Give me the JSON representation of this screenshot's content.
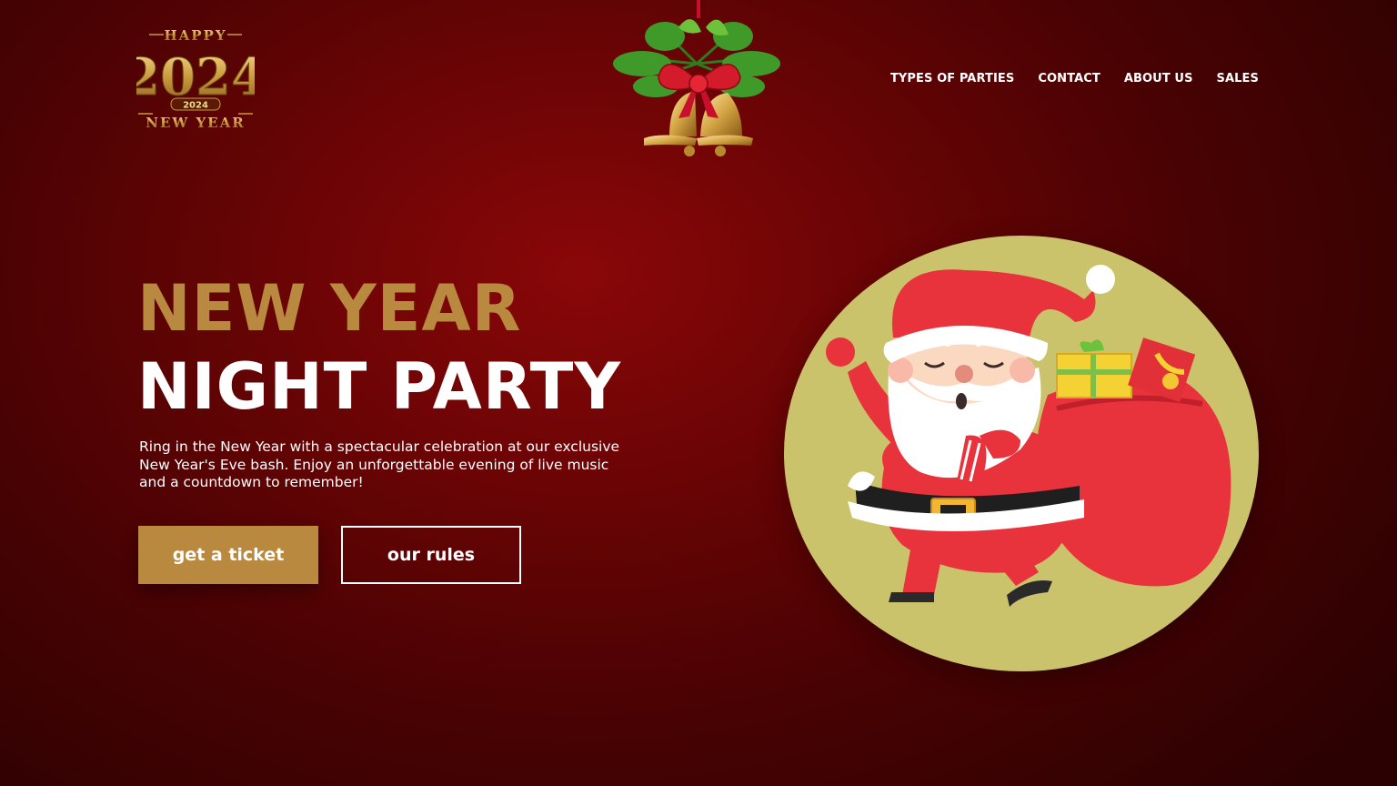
{
  "logo": {
    "top_text": "HAPPY",
    "year": "2024",
    "ribbon_year": "2024",
    "bottom_text": "NEW YEAR"
  },
  "nav": {
    "items": [
      "TYPES OF PARTIES",
      "CONTACT",
      "ABOUT US",
      "SALES"
    ]
  },
  "hero": {
    "title_line1": "NEW YEAR",
    "title_line2": "NIGHT PARTY",
    "description": "Ring in the New Year with a spectacular celebration at our exclusive New Year's Eve bash. Enjoy an unforgettable evening of live music and a countdown to remember!",
    "primary_button": "get a ticket",
    "secondary_button": "our rules"
  },
  "colors": {
    "accent_gold": "#b8893e",
    "background_red": "#8a0708",
    "circle_olive": "#cbc36b"
  },
  "icons": [
    "christmas-bells-icon",
    "santa-illustration"
  ]
}
